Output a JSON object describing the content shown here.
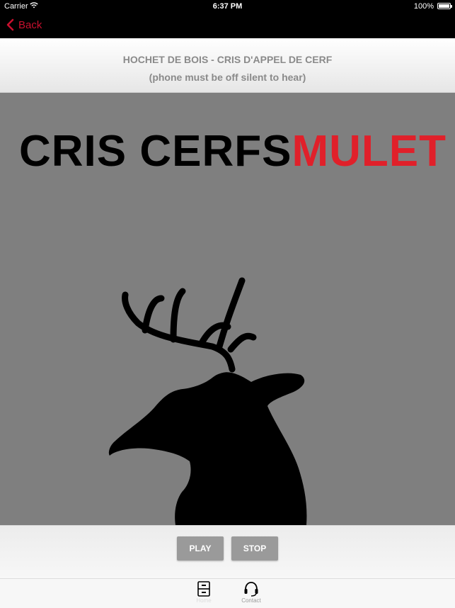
{
  "status_bar": {
    "carrier": "Carrier",
    "time": "6:37 PM",
    "battery": "100%"
  },
  "nav": {
    "back_label": "Back"
  },
  "header": {
    "title": "HOCHET DE BOIS - CRIS D'APPEL DE CERF",
    "subtitle": "(phone must be off silent to hear)"
  },
  "artwork": {
    "logo_black": "CRIS CERFS",
    "logo_red": "MULET"
  },
  "controls": {
    "play_label": "PLAY",
    "stop_label": "STOP"
  },
  "tabs": [
    {
      "label": "Home",
      "icon": "cabinet-icon"
    },
    {
      "label": "Contact",
      "icon": "headset-icon"
    }
  ],
  "colors": {
    "accent_red": "#c8102e",
    "logo_red": "#e0202a",
    "art_bg": "#7f7f7f",
    "button_gray": "#9a9a9a"
  }
}
